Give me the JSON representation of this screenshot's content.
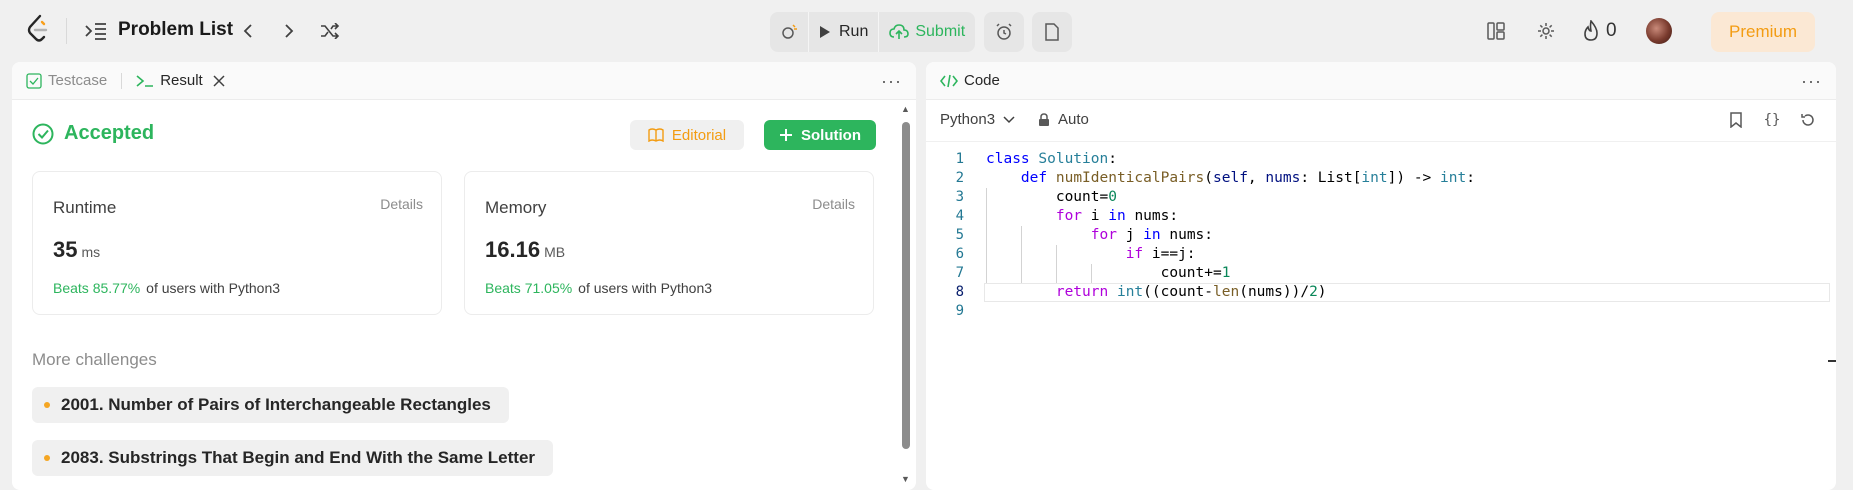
{
  "header": {
    "title": "Problem List",
    "run_label": "Run",
    "submit_label": "Submit",
    "streak_count": "0",
    "premium_label": "Premium"
  },
  "result_panel": {
    "tabs": [
      {
        "label": "Testcase"
      },
      {
        "label": "Result"
      }
    ],
    "status": "Accepted",
    "editorial_label": "Editorial",
    "solution_label": "Solution",
    "runtime": {
      "label": "Runtime",
      "details": "Details",
      "value": "35",
      "unit": "ms",
      "beats": "Beats 85.77%",
      "suffix": "of users with Python3"
    },
    "memory": {
      "label": "Memory",
      "details": "Details",
      "value": "16.16",
      "unit": "MB",
      "beats": "Beats 71.05%",
      "suffix": "of users with Python3"
    },
    "more_title": "More challenges",
    "challenges": [
      "2001. Number of Pairs of Interchangeable Rectangles",
      "2083. Substrings That Begin and End With the Same Letter"
    ]
  },
  "code_panel": {
    "tab_label": "Code",
    "language": "Python3",
    "mode": "Auto",
    "line_numbers": [
      "1",
      "2",
      "3",
      "4",
      "5",
      "6",
      "7",
      "8",
      "9"
    ]
  },
  "colors": {
    "accent_green": "#2db55d",
    "accent_orange": "#f39c12",
    "premium_bg": "#fbe8d4"
  }
}
